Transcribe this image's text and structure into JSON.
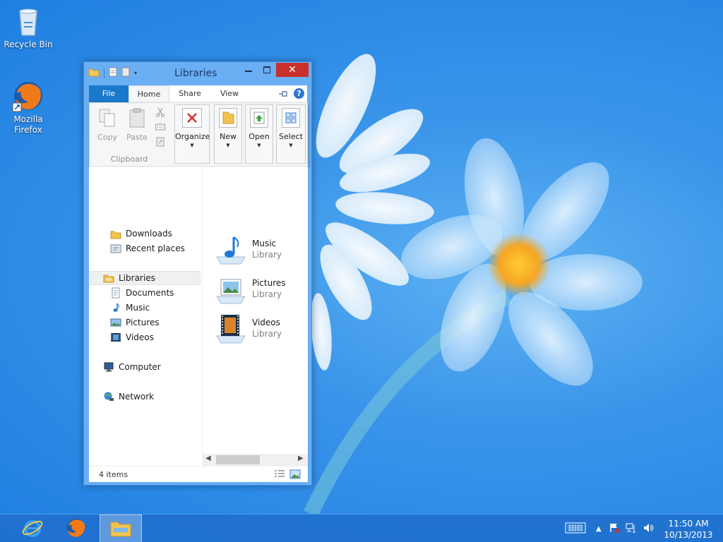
{
  "desktop": {
    "icons": [
      {
        "label": "Recycle Bin",
        "icon": "recycle-bin-icon"
      },
      {
        "label_line1": "Mozilla",
        "label_line2": "Firefox",
        "icon": "firefox-icon"
      }
    ]
  },
  "window": {
    "title": "Libraries",
    "tabs": {
      "file": "File",
      "home": "Home",
      "share": "Share",
      "view": "View"
    },
    "help": "?",
    "ribbon": {
      "copy": "Copy",
      "paste": "Paste",
      "clipboard_group": "Clipboard",
      "organize": "Organize",
      "new": "New",
      "open": "Open",
      "select": "Select"
    },
    "nav": {
      "downloads": "Downloads",
      "recent_places": "Recent places",
      "libraries": "Libraries",
      "documents": "Documents",
      "music": "Music",
      "pictures": "Pictures",
      "videos": "Videos",
      "computer": "Computer",
      "network": "Network"
    },
    "libraries": [
      {
        "name": "Music",
        "type": "Library",
        "icon": "music-library-icon"
      },
      {
        "name": "Pictures",
        "type": "Library",
        "icon": "pictures-library-icon"
      },
      {
        "name": "Videos",
        "type": "Library",
        "icon": "videos-library-icon"
      }
    ],
    "status": {
      "item_count": "4 items"
    }
  },
  "taskbar": {
    "pinned": [
      "internet-explorer-icon",
      "firefox-icon",
      "file-explorer-icon"
    ],
    "clock": {
      "time": "11:50 AM",
      "date": "10/13/2013"
    }
  },
  "colors": {
    "accent": "#1979ca",
    "close": "#c9302c",
    "window_border": "#6aaef4",
    "taskbar": "#206ecc"
  }
}
